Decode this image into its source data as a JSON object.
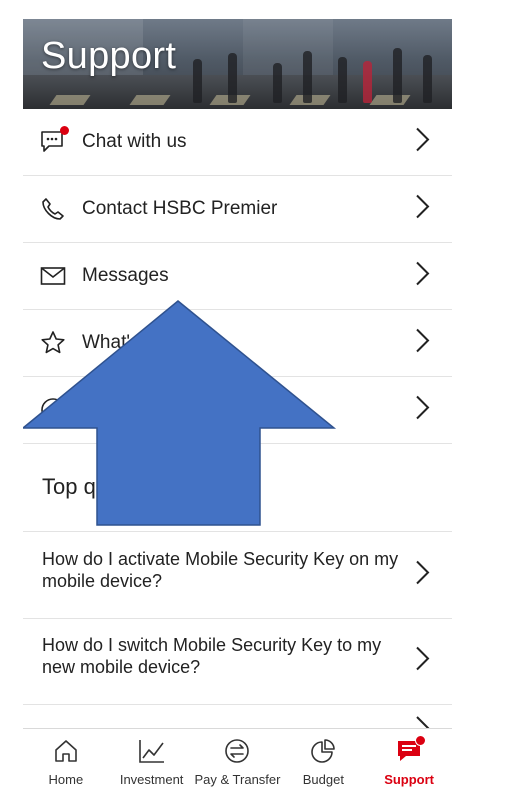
{
  "header": {
    "title": "Support"
  },
  "menu": [
    {
      "label": "Chat with us",
      "icon": "chat-icon",
      "has_notification": true
    },
    {
      "label": "Contact HSBC Premier",
      "icon": "phone-icon"
    },
    {
      "label": "Messages",
      "icon": "mail-icon"
    },
    {
      "label": "What's new",
      "icon": "star-icon"
    },
    {
      "label": "",
      "icon": "help-icon"
    }
  ],
  "top_questions": {
    "title": "Top questions",
    "items": [
      {
        "text": "How do I activate Mobile Security Key on my mobile device?"
      },
      {
        "text": "How do I switch Mobile Security Key to my new mobile device?"
      }
    ]
  },
  "nav": [
    {
      "label": "Home",
      "icon": "home-icon",
      "active": false
    },
    {
      "label": "Investment",
      "icon": "chart-icon",
      "active": false
    },
    {
      "label": "Pay & Transfer",
      "icon": "transfer-icon",
      "active": false
    },
    {
      "label": "Budget",
      "icon": "pie-chart-icon",
      "active": false
    },
    {
      "label": "Support",
      "icon": "support-icon",
      "active": true,
      "has_notification": true
    }
  ],
  "colors": {
    "accent": "#db0011",
    "arrow_fill": "#4472c4",
    "arrow_stroke": "#2f528f"
  }
}
